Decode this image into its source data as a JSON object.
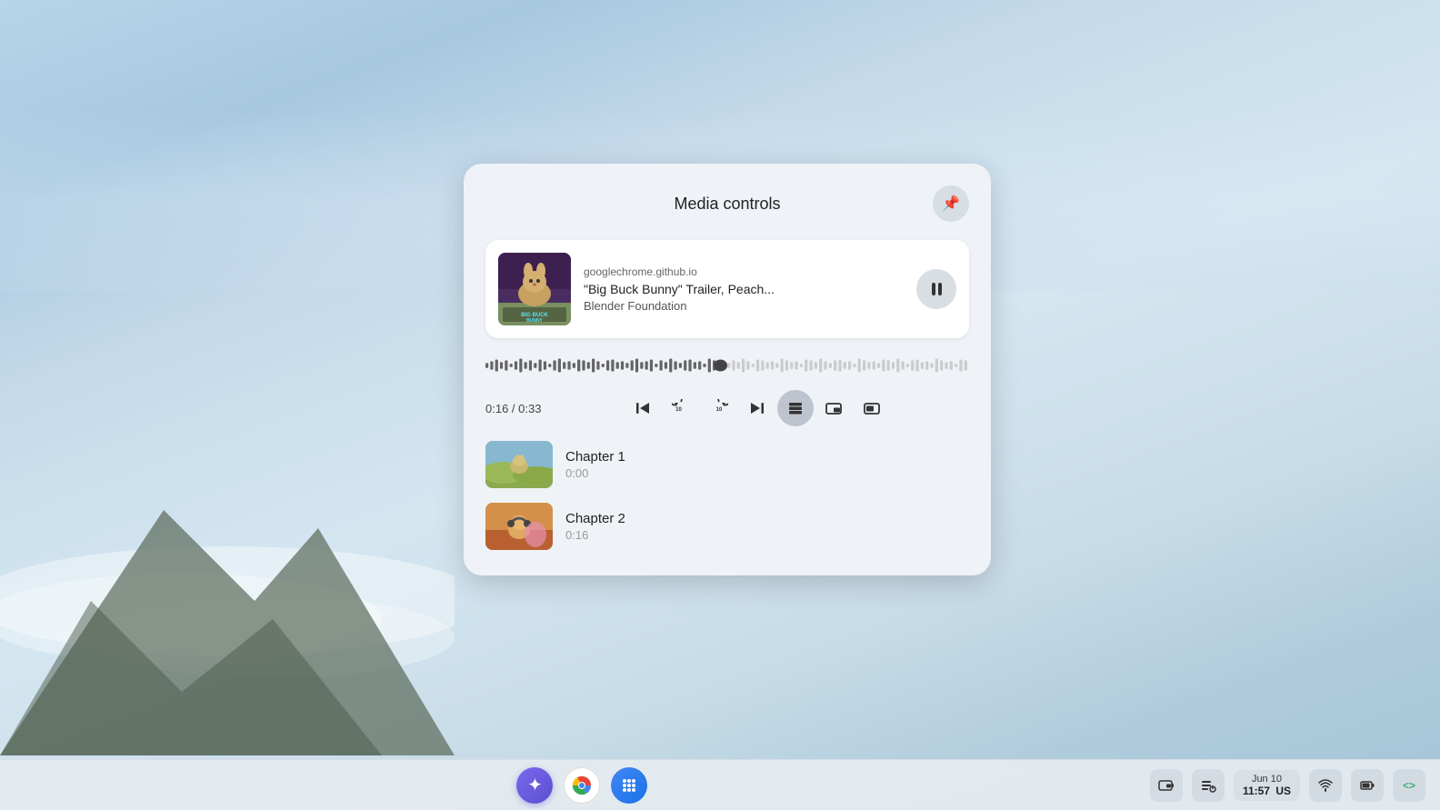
{
  "desktop": {
    "background": "sky blue gradient with mountains and clouds"
  },
  "media_controls": {
    "title": "Media controls",
    "pin_button_label": "📌",
    "source": "googlechrome.github.io",
    "media_name": "\"Big Buck Bunny\" Trailer, Peach...",
    "artist": "Blender Foundation",
    "current_time": "0:16",
    "total_time": "0:33",
    "time_display": "0:16 / 0:33",
    "progress_percent": 48,
    "controls": {
      "skip_back": "⏮",
      "rewind_10": "↺10",
      "forward_10": "↻10",
      "skip_next": "⏭",
      "chapters_active": true
    },
    "chapters": [
      {
        "name": "Chapter 1",
        "time": "0:00",
        "thumb_style": "meadow"
      },
      {
        "name": "Chapter 2",
        "time": "0:16",
        "thumb_style": "character"
      }
    ]
  },
  "taskbar": {
    "date": "Jun 10",
    "time": "11:57",
    "locale": "US",
    "apps": [
      {
        "name": "Launcher",
        "label": "✦"
      },
      {
        "name": "Chrome",
        "label": ""
      },
      {
        "name": "App Grid",
        "label": "⠿"
      }
    ],
    "system_icons": [
      {
        "name": "media-controls-sys",
        "label": "🎵"
      },
      {
        "name": "playlist",
        "label": "≡♪"
      },
      {
        "name": "wifi",
        "label": "▲"
      },
      {
        "name": "battery",
        "label": "▮"
      },
      {
        "name": "dev-tools",
        "label": "<>"
      }
    ]
  }
}
